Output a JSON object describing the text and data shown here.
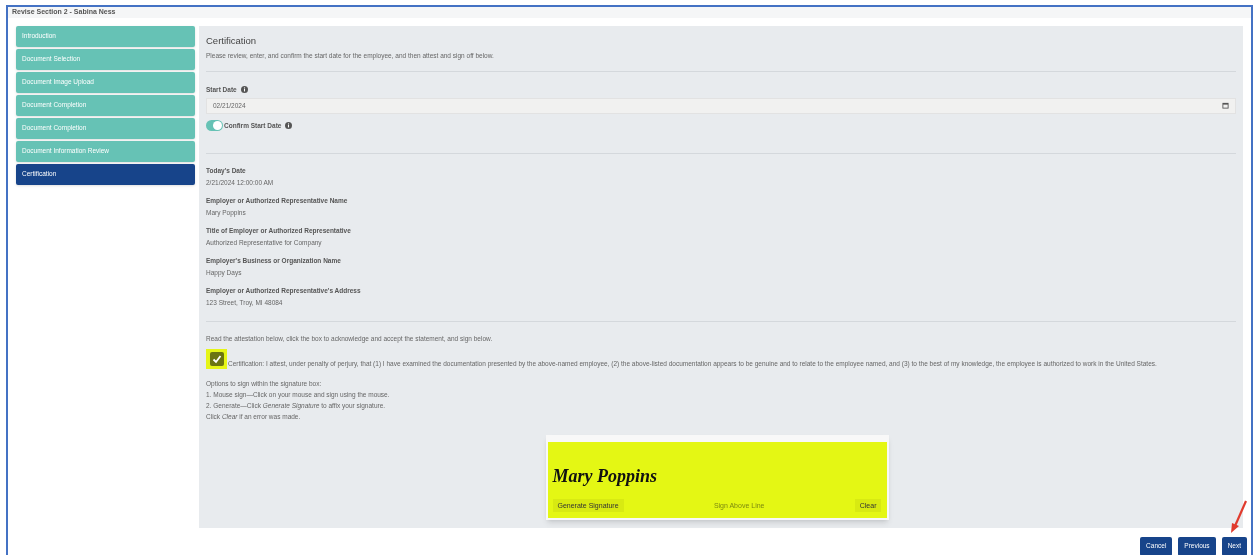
{
  "window": {
    "title": "Revise Section 2 - Sabina Ness"
  },
  "sidebar": {
    "items": [
      {
        "label": "Introduction",
        "selected": false
      },
      {
        "label": "Document Selection",
        "selected": false
      },
      {
        "label": "Document Image Upload",
        "selected": false
      },
      {
        "label": "Document Completion",
        "selected": false
      },
      {
        "label": "Document Completion",
        "selected": false
      },
      {
        "label": "Document Information Review",
        "selected": false
      },
      {
        "label": "Certification",
        "selected": true
      }
    ]
  },
  "section": {
    "title": "Certification",
    "intro": "Please review, enter, and confirm the start date for the employee, and then attest and sign off below.",
    "start_date": {
      "label": "Start Date",
      "value": "02/21/2024"
    },
    "confirm": {
      "label": "Confirm Start Date",
      "on": true
    },
    "fields": [
      {
        "label": "Today's Date",
        "value": "2/21/2024 12:00:00 AM"
      },
      {
        "label": "Employer or Authorized Representative Name",
        "value": "Mary Poppins"
      },
      {
        "label": "Title of Employer or Authorized Representative",
        "value": "Authorized Representative for Company"
      },
      {
        "label": "Employer's Business or Organization Name",
        "value": "Happy Days"
      },
      {
        "label": "Employer or Authorized Representative's Address",
        "value": "123 Street, Troy, MI 48084"
      }
    ],
    "attest_intro": "Read the attestation below, click the box to acknowledge and accept the statement, and sign below.",
    "attestation": {
      "checked": true,
      "text": "Certification: I attest, under penalty of perjury, that (1) I have examined the documentation presented by the above-named employee, (2) the above-listed documentation appears to be genuine and to relate to the employee named, and (3) to the best of my knowledge, the employee is authorized to work in the United States."
    },
    "instructions": [
      "Options to sign within the signature box:",
      "1. Mouse sign—Click on your mouse and sign using the mouse.",
      "2. Generate—Click *Generate Signature* to affix your signature.",
      "Click *Clear* if an error was made."
    ],
    "signature": {
      "value": "Mary Poppins",
      "generate_button": "Generate Signature",
      "line_label": "Sign Above Line",
      "clear_button": "Clear"
    }
  },
  "buttons": [
    "Cancel",
    "Previous",
    "Next"
  ]
}
